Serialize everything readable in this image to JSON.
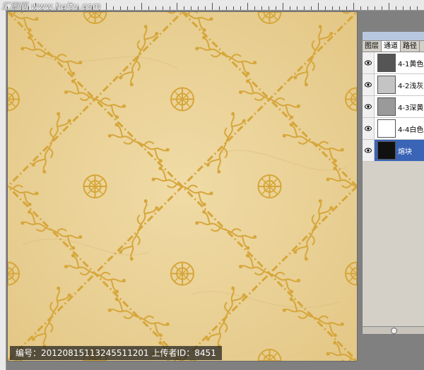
{
  "watermark": {
    "text": "汇图网 www.huitu.com"
  },
  "caption": {
    "text": "编号：20120815113245511201 上传者ID：8451"
  },
  "panel": {
    "tabs": [
      {
        "label": "图层",
        "active": false
      },
      {
        "label": "通道",
        "active": true
      },
      {
        "label": "路径",
        "active": false
      }
    ],
    "layers": [
      {
        "label": "4-1黄色",
        "thumb": "#555555",
        "selected": false
      },
      {
        "label": "4-2浅灰",
        "thumb": "#c4c4c4",
        "selected": false
      },
      {
        "label": "4-3深黄",
        "thumb": "#9a9a9a",
        "selected": false
      },
      {
        "label": "4-4白色",
        "thumb": "#ffffff",
        "selected": false
      },
      {
        "label": "熔块",
        "thumb": "#111111",
        "selected": true
      }
    ]
  },
  "colors": {
    "canvas_base": "#e8cf93",
    "ornament": "#d6a63a",
    "selection": "#3a64b6"
  }
}
